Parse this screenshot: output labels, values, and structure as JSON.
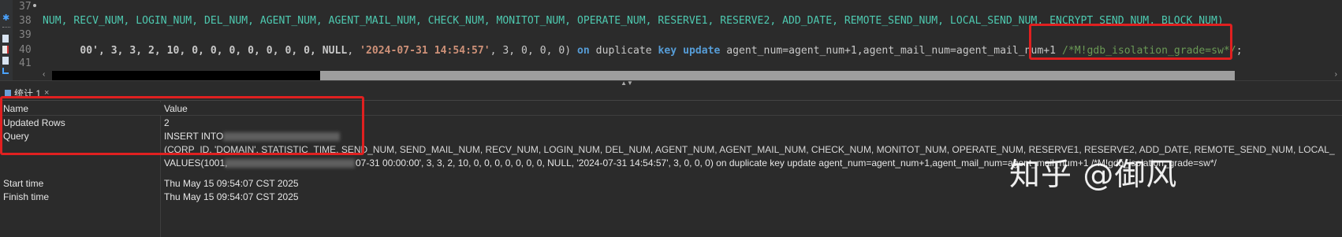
{
  "editor": {
    "line_numbers": [
      "37",
      "38",
      "39",
      "40",
      "41"
    ],
    "line38": "NUM, RECV_NUM, LOGIN_NUM, DEL_NUM, AGENT_NUM, AGENT_MAIL_NUM, CHECK_NUM, MONITOT_NUM, OPERATE_NUM, RESERVE1, RESERVE2, ADD_DATE, REMOTE_SEND_NUM, LOCAL_SEND_NUM, ENCRYPT_SEND_NUM, BLOCK_NUM)",
    "line39": {
      "head": "00', 3, 3, 2, 10, 0, 0, 0, 0, 0, 0, 0, ",
      "null": "NULL",
      "sep1": ", ",
      "date": "'2024-07-31 14:54:57'",
      "nums": ", 3, 0, 0, 0) ",
      "on": "on",
      "duplicate": " duplicate ",
      "key": "key",
      "sp": " ",
      "update": "update",
      "tail": " agent_num=agent_num+1,agent_mail_num=agent_mail_num+1 ",
      "comment": "/*M!gdb_isolation_grade=sw*/",
      "end": ";"
    }
  },
  "panel": {
    "tab_label": "统计 1",
    "tab_close": "×",
    "headers": {
      "name": "Name",
      "value": "Value"
    },
    "rows": {
      "updated_rows": {
        "name": "Updated Rows",
        "value": "2"
      },
      "query": {
        "name": "Query",
        "line1": "INSERT INTO ",
        "line2": "(CORP_ID, 'DOMAIN', STATISTIC_TIME, SEND_NUM, SEND_MAIL_NUM, RECV_NUM, LOGIN_NUM, DEL_NUM, AGENT_NUM, AGENT_MAIL_NUM, CHECK_NUM, MONITOT_NUM, OPERATE_NUM, RESERVE1, RESERVE2, ADD_DATE, REMOTE_SEND_NUM, LOCAL_",
        "line3a": "VALUES(1001, ",
        "line3b": "07-31 00:00:00', 3, 3, 2, 10, 0, 0, 0, 0, 0, 0, 0, NULL, '2024-07-31 14:54:57', 3, 0, 0, 0) on duplicate key update agent_num=agent_num+1,agent_mail_num=agent_mail_num+1 /*M!gdb_isolation_grade=sw*/"
      },
      "start_time": {
        "name": "Start time",
        "value": "Thu May 15 09:54:07 CST 2025"
      },
      "finish_time": {
        "name": "Finish time",
        "value": "Thu May 15 09:54:07 CST 2025"
      }
    }
  },
  "watermark": "知乎 @御风",
  "colors": {
    "highlight_box": "#e02020",
    "column_names": "#4ec9b0",
    "keyword": "#569cd6",
    "string": "#ce9178",
    "comment": "#6a9955"
  }
}
